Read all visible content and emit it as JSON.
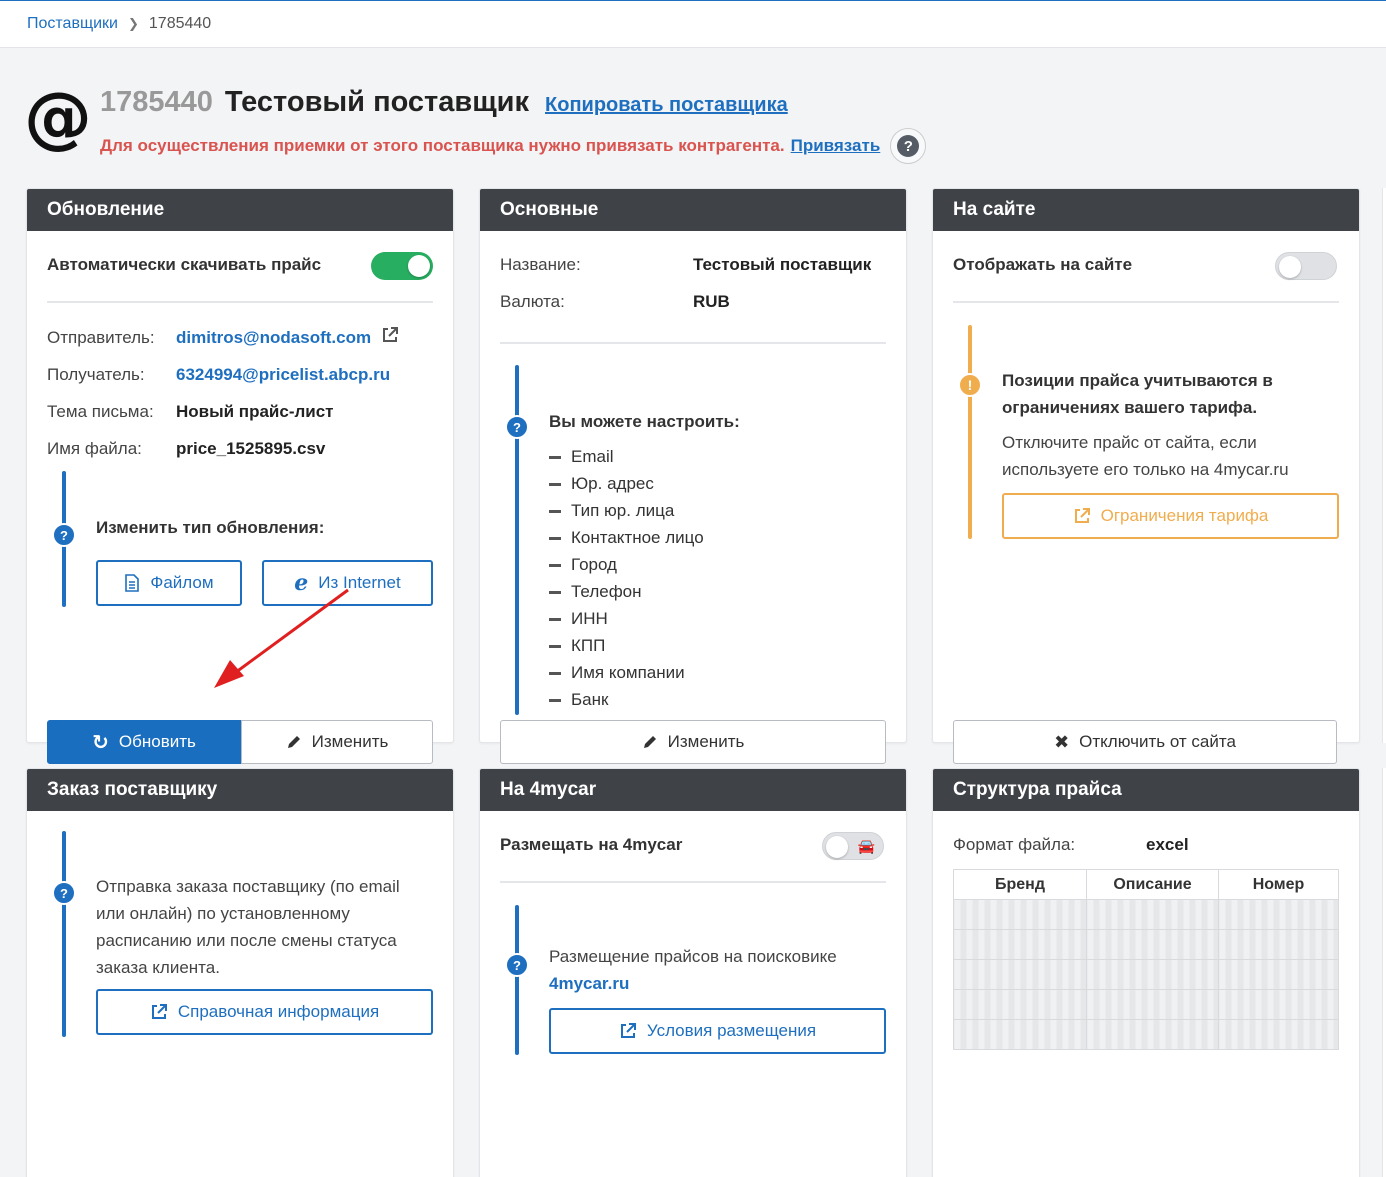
{
  "breadcrumb": {
    "root": "Поставщики",
    "current": "1785440"
  },
  "header": {
    "id": "1785440",
    "name": "Тестовый поставщик",
    "copy_link": "Копировать поставщика",
    "warning": "Для осуществления приемки от этого поставщика нужно привязать контрагента.",
    "bind_link": "Привязать"
  },
  "update_card": {
    "title": "Обновление",
    "auto_label": "Автоматически скачивать прайс",
    "auto_on": true,
    "sender_label": "Отправитель:",
    "sender": "dimitros@nodasoft.com",
    "recipient_label": "Получатель:",
    "recipient": "6324994@pricelist.abcp.ru",
    "subject_label": "Тема письма:",
    "subject": "Новый прайс-лист",
    "filename_label": "Имя файла:",
    "filename": "price_1525895.csv",
    "change_type": "Изменить тип обновления:",
    "btn_file": "Файлом",
    "btn_internet": "Из Internet",
    "btn_refresh": "Обновить",
    "btn_edit": "Изменить"
  },
  "main_card": {
    "title": "Основные",
    "name_label": "Название:",
    "name": "Тестовый поставщик",
    "currency_label": "Валюта:",
    "currency": "RUB",
    "can_configure": "Вы можете настроить:",
    "items": [
      "Email",
      "Юр. адрес",
      "Тип юр. лица",
      "Контактное лицо",
      "Город",
      "Телефон",
      "ИНН",
      "КПП",
      "Имя компании",
      "Банк"
    ],
    "btn_edit": "Изменить"
  },
  "site_card": {
    "title": "На сайте",
    "show_label": "Отображать на сайте",
    "show_on": false,
    "notice_bold": "Позиции прайса учитываются в ограничениях вашего тарифа.",
    "notice_text": "Отключите прайс от сайта, если используете его только на 4mycar.ru",
    "btn_limits": "Ограничения тарифа",
    "btn_disconnect": "Отключить от сайта"
  },
  "order_card": {
    "title": "Заказ поставщику",
    "text": "Отправка заказа поставщику (по email или онлайн) по установленному расписанию или после смены статуса заказа клиента.",
    "btn_info": "Справочная информация"
  },
  "mycar_card": {
    "title": "На 4mycar",
    "place_label": "Размещать на 4mycar",
    "place_on": false,
    "text": "Размещение прайсов на поисковике",
    "link": "4mycar.ru",
    "btn_terms": "Условия размещения"
  },
  "structure_card": {
    "title": "Структура прайса",
    "format_label": "Формат файла:",
    "format": "excel",
    "columns": [
      "Бренд",
      "Описание",
      "Номер"
    ]
  },
  "colors": {
    "accent": "#1e6fbf",
    "warning": "#d9534f",
    "orange": "#f0ad4e",
    "success": "#27ae60",
    "header": "#3f4247"
  }
}
